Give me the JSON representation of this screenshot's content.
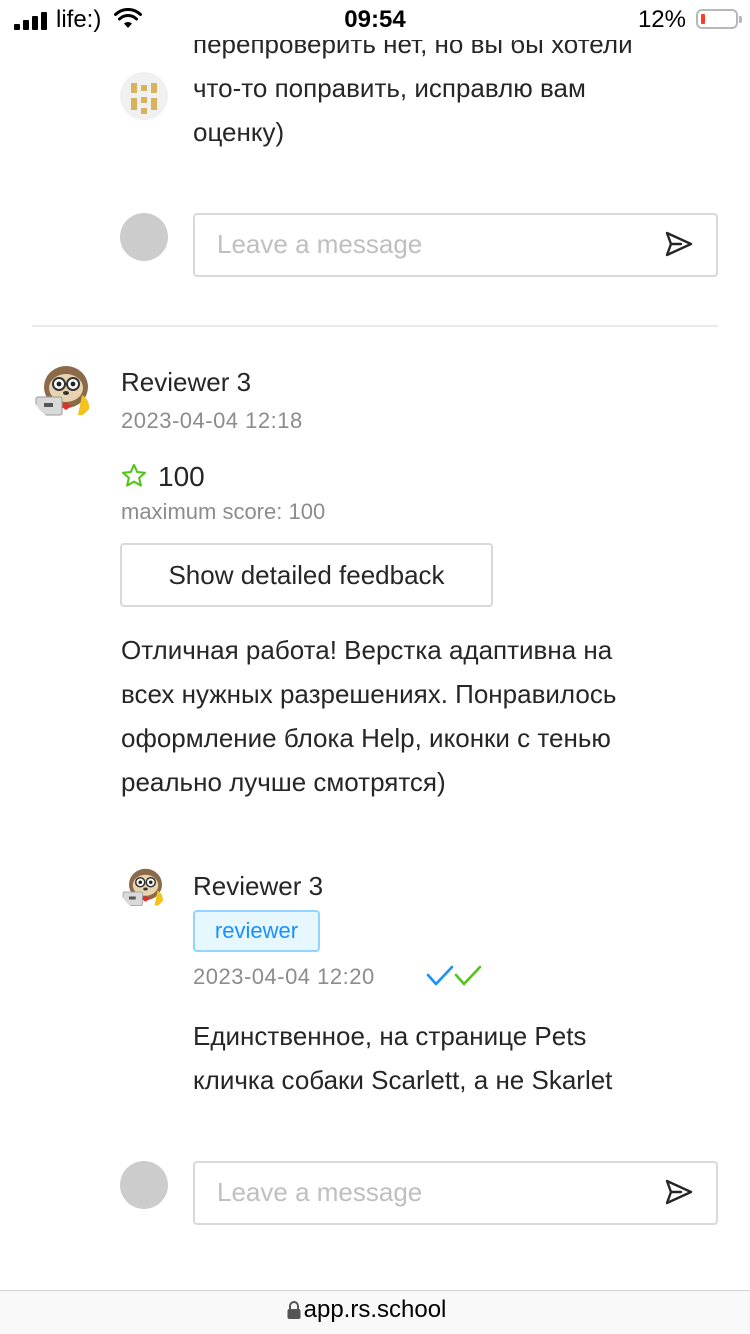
{
  "status_bar": {
    "carrier": "life:)",
    "time": "09:54",
    "battery_percent": "12%",
    "battery_level": 0.12,
    "icons": [
      "signal-icon",
      "wifi-icon",
      "battery-icon"
    ]
  },
  "top_comment": {
    "text_lines": [
      "перепроверить нет, но вы бы хотели",
      "что-то поправить, исправлю вам",
      "оценку)"
    ],
    "message_input": {
      "placeholder": "Leave a message"
    }
  },
  "review": {
    "reviewer_name": "Reviewer 3",
    "date": "2023-04-04 12:18",
    "score": "100",
    "max_score_text": "maximum score: 100",
    "detail_button": "Show detailed feedback",
    "text_lines": [
      "Отличная работа! Верстка адаптивна на",
      "всех нужных разрешениях. Понравилось",
      "оформление блока Help, иконки с тенью",
      "реально лучше смотрятся)"
    ],
    "reply": {
      "reviewer_name": "Reviewer 3",
      "tag": "reviewer",
      "date": "2023-04-04 12:20",
      "text_lines": [
        "Единственное, на странице Pets",
        "кличка собаки Scarlett, а не Skarlet"
      ]
    },
    "message_input": {
      "placeholder": "Leave a message"
    }
  },
  "browser": {
    "url": "app.rs.school"
  },
  "colors": {
    "star": "#52c41a",
    "tag_text": "#1890ff",
    "tag_bg": "#e6f7ff",
    "check_blue": "#1890ff",
    "check_green": "#52c41a",
    "battery_low": "#ff3b30",
    "avatar_gold": "#d6b35c"
  }
}
